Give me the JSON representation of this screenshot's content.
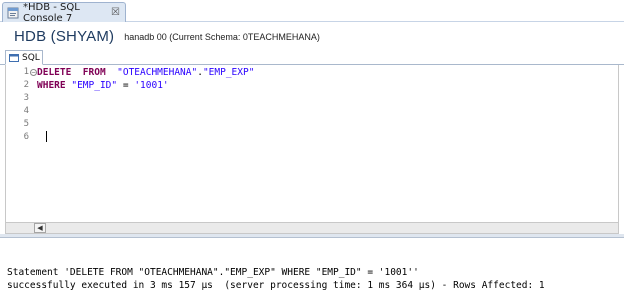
{
  "tab": {
    "title": "*HDB - SQL Console 7",
    "close_glyph": "☒",
    "icon": "sql-console-icon"
  },
  "header": {
    "title": "HDB (SHYAM)",
    "connection": "hanadb 00 (Current Schema: 0TEACHMEHANA)"
  },
  "subtab": {
    "label": "SQL",
    "icon": "sql-icon"
  },
  "editor": {
    "line_numbers": [
      "1",
      "2",
      "3",
      "4",
      "5",
      "6"
    ],
    "lines": [
      {
        "kw1": "DELETE",
        "kw2": "FROM",
        "id1": "\"OTEACHMEHANA\"",
        "sep": ".",
        "id2": "\"EMP_EXP\""
      },
      {
        "kw1": "WHERE",
        "id1": "\"EMP_ID\"",
        "op": "=",
        "val": "'1001'"
      }
    ]
  },
  "scrollbar": {
    "left_arrow": "◀"
  },
  "results": {
    "line1": "Statement 'DELETE FROM \"OTEACHMEHANA\".\"EMP_EXP\" WHERE \"EMP_ID\" = '1001''",
    "line2": "successfully executed in 3 ms 157 µs  (server processing time: 1 ms 364 µs) - Rows Affected: 1"
  },
  "colors": {
    "keyword": "#7f0055",
    "identifier": "#2a00ff",
    "header_title": "#1d3a5f"
  }
}
